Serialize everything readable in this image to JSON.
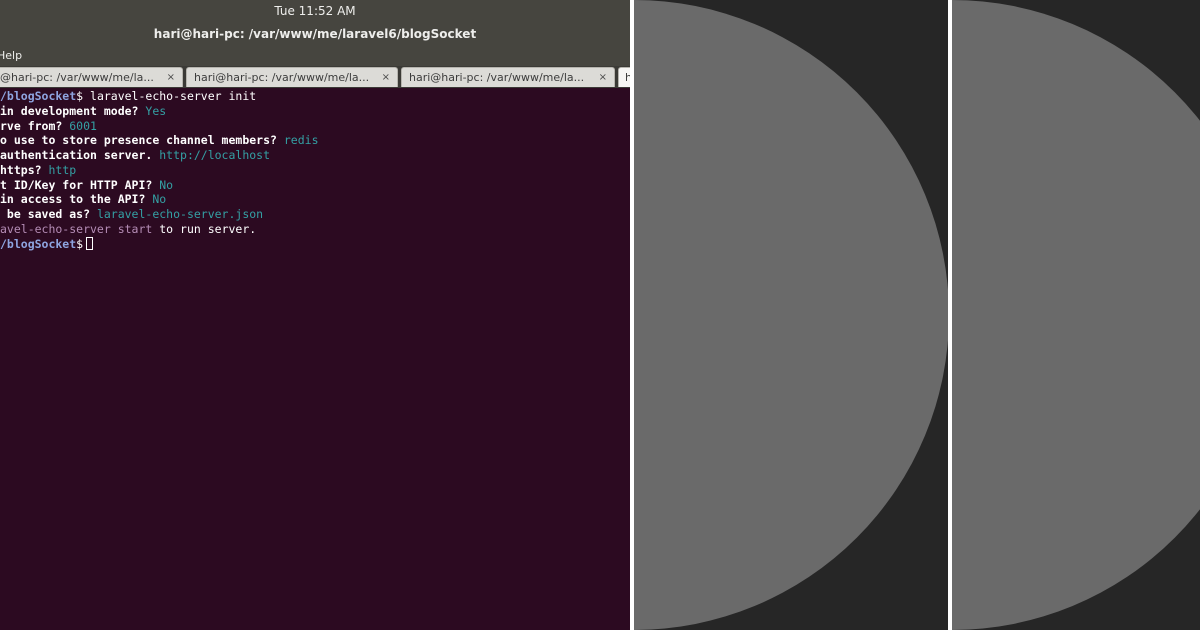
{
  "system": {
    "clock": "Tue 11:52 AM"
  },
  "window": {
    "title": "hari@hari-pc: /var/www/me/laravel6/blogSocket"
  },
  "menu": {
    "help_label": "Help"
  },
  "tabs": [
    {
      "label": "@hari-pc: /var/www/me/la...",
      "close": "×"
    },
    {
      "label": "hari@hari-pc: /var/www/me/la...",
      "close": "×"
    },
    {
      "label": "hari@hari-pc: /var/www/me/la...",
      "close": "×"
    },
    {
      "label": "h"
    }
  ],
  "terminal": {
    "line1": {
      "prompt": "/blogSocket",
      "cmd": "$ laravel-echo-server init"
    },
    "line2": {
      "question": "in development mode? ",
      "answer": "Yes"
    },
    "line3": {
      "question": "rve from? ",
      "answer": "6001"
    },
    "line4": {
      "question": "o use to store presence channel members? ",
      "answer": "redis"
    },
    "line5": {
      "question": "authentication server. ",
      "answer": "http://localhost"
    },
    "line6": {
      "question": "https? ",
      "answer": "http"
    },
    "line7": {
      "question": "t ID/Key for HTTP API? ",
      "answer": "No"
    },
    "line8": {
      "question": "in access to the API? ",
      "answer": "No"
    },
    "line9": {
      "question": " be saved as? ",
      "answer": "laravel-echo-server.json"
    },
    "line10": {
      "highlight": "avel-echo-server start",
      "rest": " to run server."
    },
    "line11": {
      "prompt": "/blogSocket",
      "cmd": "$"
    }
  },
  "colors": {
    "terminal_bg": "#2c0a21",
    "answer_teal": "#34a0a4",
    "prompt_blue": "#8ea4e0",
    "panel_dark": "#262626",
    "circle_gray": "#6a6a6a"
  }
}
